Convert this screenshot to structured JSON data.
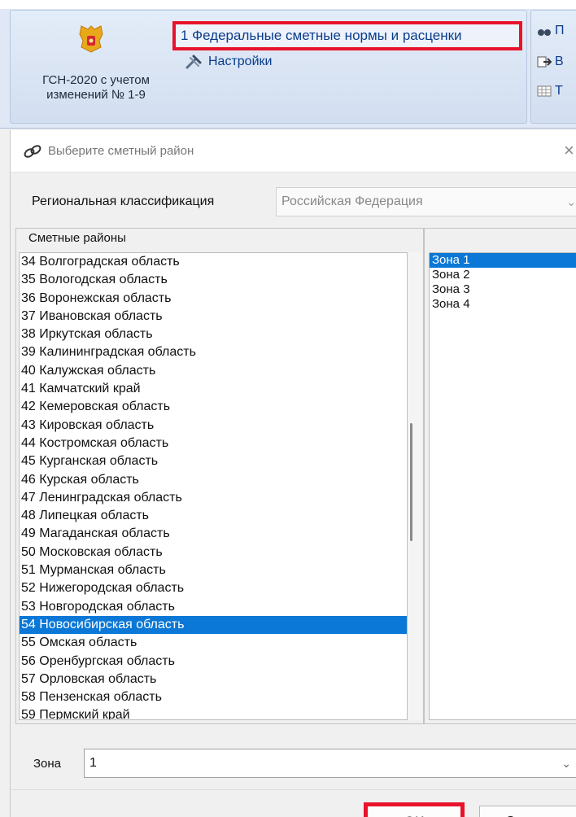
{
  "ribbon": {
    "base_name": "ГСН-2020 с учетом изменений № 1-9",
    "fsnb_label": "1 Федеральные сметные нормы и расценки",
    "settings_label": "Настройки",
    "side_items": [
      "П",
      "В",
      "Т"
    ],
    "highlight_color": "#e8132a"
  },
  "dialog": {
    "title": "Выберите сметный район",
    "close_glyph": "×",
    "region_label": "Региональная классификация",
    "region_value": "Российская Федерация",
    "group_title": "Сметные районы",
    "districts": [
      "34 Волгоградская область",
      "35 Вологодская область",
      "36 Воронежская область",
      "37 Ивановская область",
      "38 Иркутская область",
      "39 Калининградская область",
      "40 Калужская область",
      "41 Камчатский край",
      "42 Кемеровская область",
      "43 Кировская область",
      "44 Костромская область",
      "45 Курганская область",
      "46 Курская область",
      "47 Ленинградская область",
      "48 Липецкая область",
      "49 Магаданская область",
      "50 Московская область",
      "51 Мурманская область",
      "52 Нижегородская область",
      "53 Новгородская область",
      "54 Новосибирская область",
      "55 Омская область",
      "56 Оренбургская область",
      "57 Орловская область",
      "58 Пензенская область",
      "59 Пермский край"
    ],
    "selected_district_index": 20,
    "zones": [
      "Зона 1",
      "Зона 2",
      "Зона 3",
      "Зона 4"
    ],
    "selected_zone_index": 0,
    "zone_label": "Зона",
    "zone_value": "1",
    "ok_label": "OK",
    "cancel_label": "Отмена",
    "selection_color": "#0b77d6"
  }
}
